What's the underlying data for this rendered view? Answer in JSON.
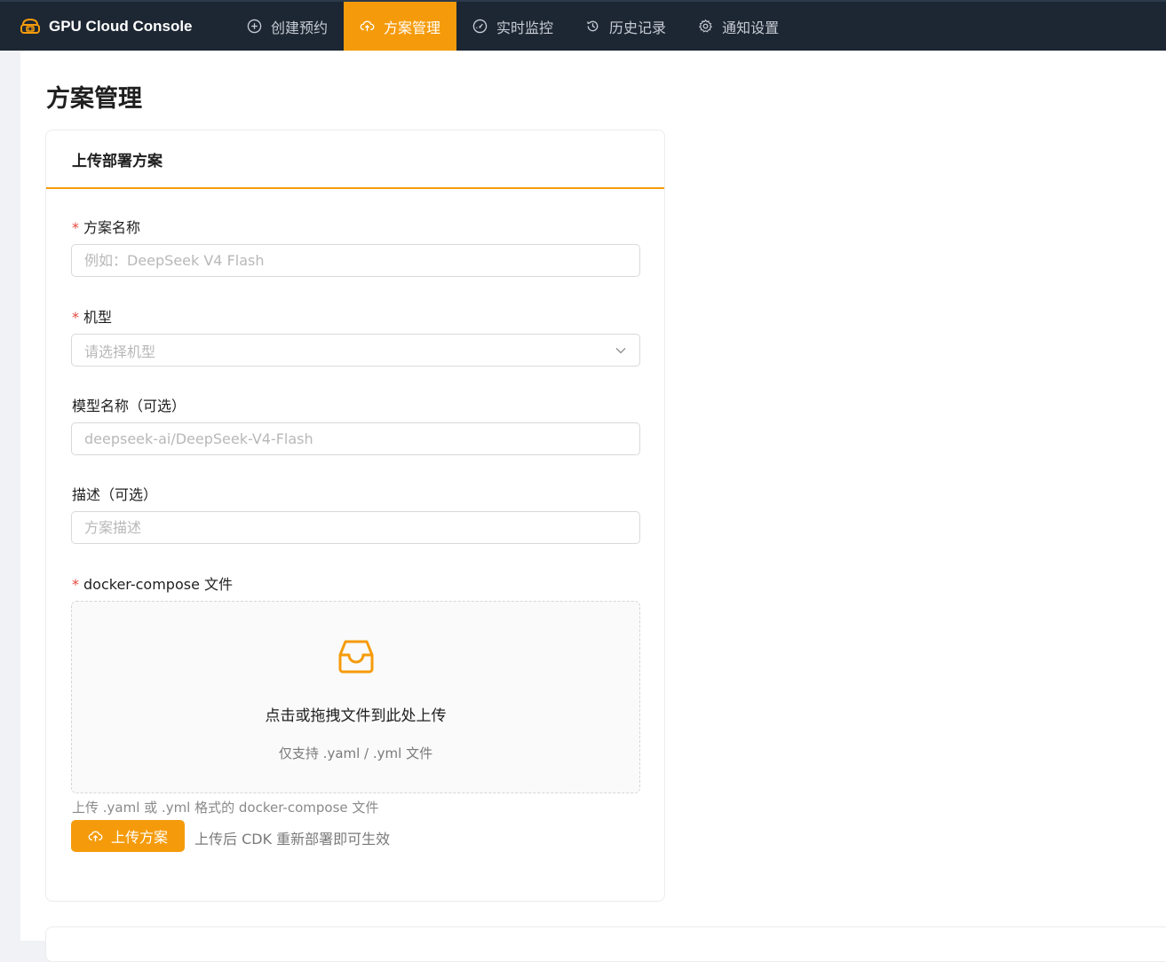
{
  "app": {
    "title": "GPU Cloud Console",
    "accent": "#f59b0b",
    "nav_bg": "#1d2733"
  },
  "nav": {
    "items": [
      {
        "label": "创建预约",
        "icon": "plus-circle-icon"
      },
      {
        "label": "方案管理",
        "icon": "cloud-upload-icon",
        "active": true
      },
      {
        "label": "实时监控",
        "icon": "dashboard-icon"
      },
      {
        "label": "历史记录",
        "icon": "history-icon"
      },
      {
        "label": "通知设置",
        "icon": "gear-icon"
      }
    ]
  },
  "page": {
    "title": "方案管理"
  },
  "form": {
    "card_title": "上传部署方案",
    "required_mark": "*",
    "plan_name": {
      "label": "方案名称",
      "placeholder": "例如：DeepSeek V4 Flash",
      "value": ""
    },
    "machine": {
      "label": "机型",
      "placeholder": "请选择机型"
    },
    "model_name": {
      "label": "模型名称（可选）",
      "placeholder": "deepseek-ai/DeepSeek-V4-Flash",
      "value": ""
    },
    "description": {
      "label": "描述（可选）",
      "placeholder": "方案描述",
      "value": ""
    },
    "compose_file": {
      "label": "docker-compose 文件",
      "drop_text": "点击或拖拽文件到此处上传",
      "drop_hint": "仅支持 .yaml / .yml 文件",
      "help": "上传 .yaml 或 .yml 格式的 docker-compose 文件"
    },
    "submit_label": "上传方案",
    "submit_note": "上传后 CDK 重新部署即可生效"
  }
}
